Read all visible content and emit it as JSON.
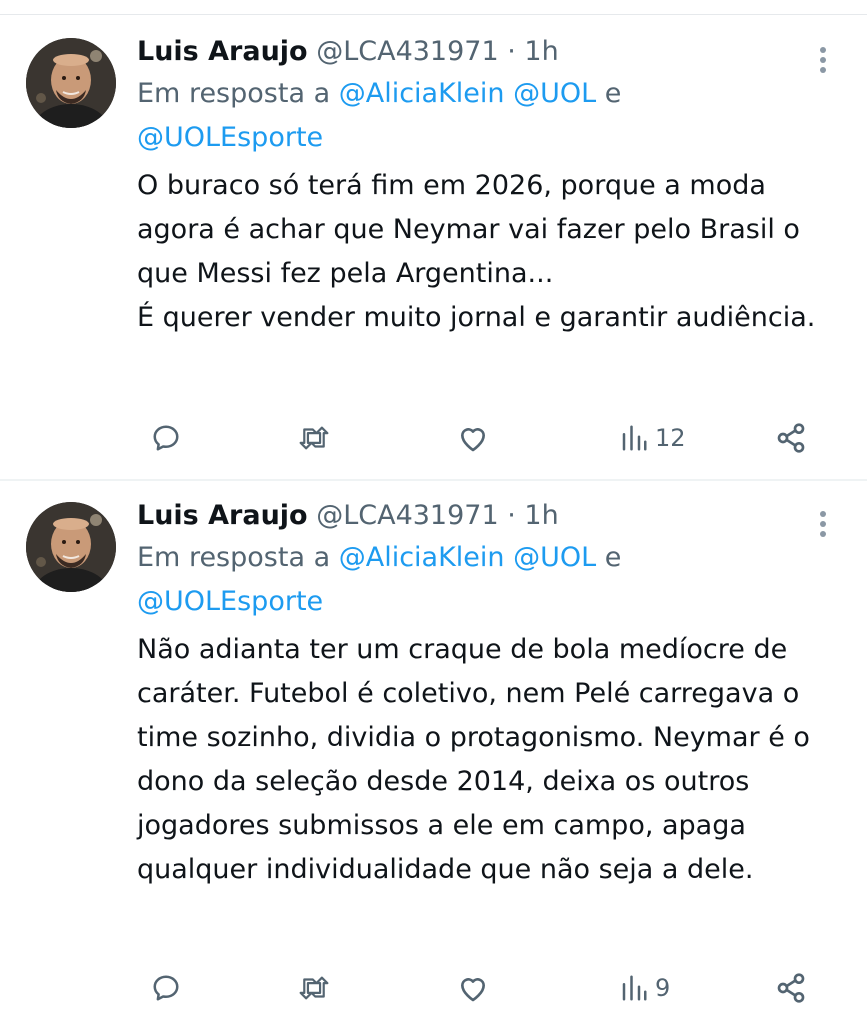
{
  "colors": {
    "accent": "#1d9bf0",
    "secondary_text": "#536471",
    "primary_text": "#0f1419",
    "divider": "#eff3f4"
  },
  "tweets": [
    {
      "display_name": "Luis Araujo",
      "handle": "@LCA431971",
      "separator": "·",
      "time": "1h",
      "reply_prefix": "Em resposta a",
      "mention_1": "@AliciaKlein",
      "mention_2": "@UOL",
      "conjunction": "e",
      "mention_3": "@UOLEsporte",
      "text": "O buraco só terá fim em 2026, porque a moda agora é achar que Neymar vai fazer pelo Brasil o que Messi fez pela Argentina...\nÉ querer vender muito jornal e garantir audiência.",
      "views": "12",
      "icons": [
        "reply-icon",
        "retweet-icon",
        "like-icon",
        "views-icon",
        "share-icon",
        "more-icon"
      ]
    },
    {
      "display_name": "Luis Araujo",
      "handle": "@LCA431971",
      "separator": "·",
      "time": "1h",
      "reply_prefix": "Em resposta a",
      "mention_1": "@AliciaKlein",
      "mention_2": "@UOL",
      "conjunction": "e",
      "mention_3": "@UOLEsporte",
      "text": "Não adianta ter um craque de bola medíocre de caráter. Futebol é coletivo, nem Pelé carregava o time sozinho, dividia o protagonismo. Neymar é o dono da seleção desde 2014, deixa os outros jogadores submissos a ele em campo, apaga qualquer individualidade que não seja a dele.",
      "views": "9",
      "icons": [
        "reply-icon",
        "retweet-icon",
        "like-icon",
        "views-icon",
        "share-icon",
        "more-icon"
      ]
    }
  ]
}
